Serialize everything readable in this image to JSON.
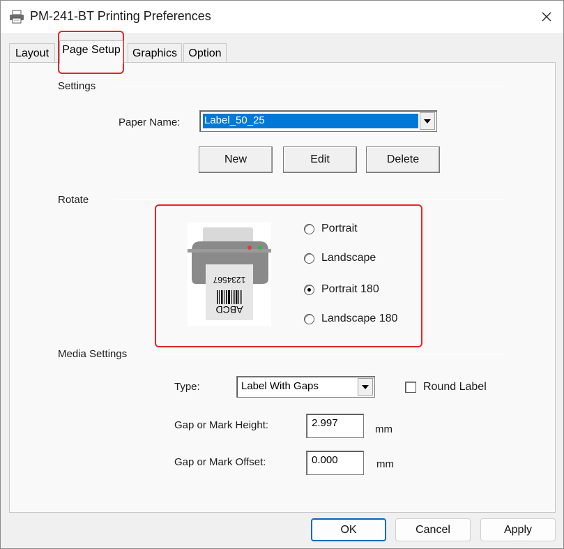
{
  "window": {
    "title": "PM-241-BT Printing Preferences",
    "icon": "printer-icon",
    "close_icon": "close-icon"
  },
  "tabs": [
    {
      "label": "Layout",
      "active": false
    },
    {
      "label": "Page Setup",
      "active": true
    },
    {
      "label": "Graphics",
      "active": false
    },
    {
      "label": "Option",
      "active": false
    }
  ],
  "settings": {
    "group_label": "Settings",
    "paper_name_label": "Paper Name:",
    "paper_name_value": "Label_50_25",
    "new_label": "New",
    "edit_label": "Edit",
    "delete_label": "Delete"
  },
  "rotate": {
    "group_label": "Rotate",
    "preview_text_number": "1234567",
    "preview_text_letters": "ABCD",
    "options": [
      {
        "label": "Portrait",
        "checked": false
      },
      {
        "label": "Landscape",
        "checked": false
      },
      {
        "label": "Portrait 180",
        "checked": true
      },
      {
        "label": "Landscape 180",
        "checked": false
      }
    ]
  },
  "media": {
    "group_label": "Media Settings",
    "type_label": "Type:",
    "type_value": "Label With Gaps",
    "round_label": "Round Label",
    "round_checked": false,
    "gap_height_label": "Gap or Mark Height:",
    "gap_height_value": "2.997",
    "gap_height_unit": "mm",
    "gap_offset_label": "Gap or Mark Offset:",
    "gap_offset_value": "0.000",
    "gap_offset_unit": "mm"
  },
  "footer": {
    "ok_label": "OK",
    "cancel_label": "Cancel",
    "apply_label": "Apply"
  },
  "colors": {
    "accent": "#0078d7",
    "highlight_red": "#e0262b"
  }
}
